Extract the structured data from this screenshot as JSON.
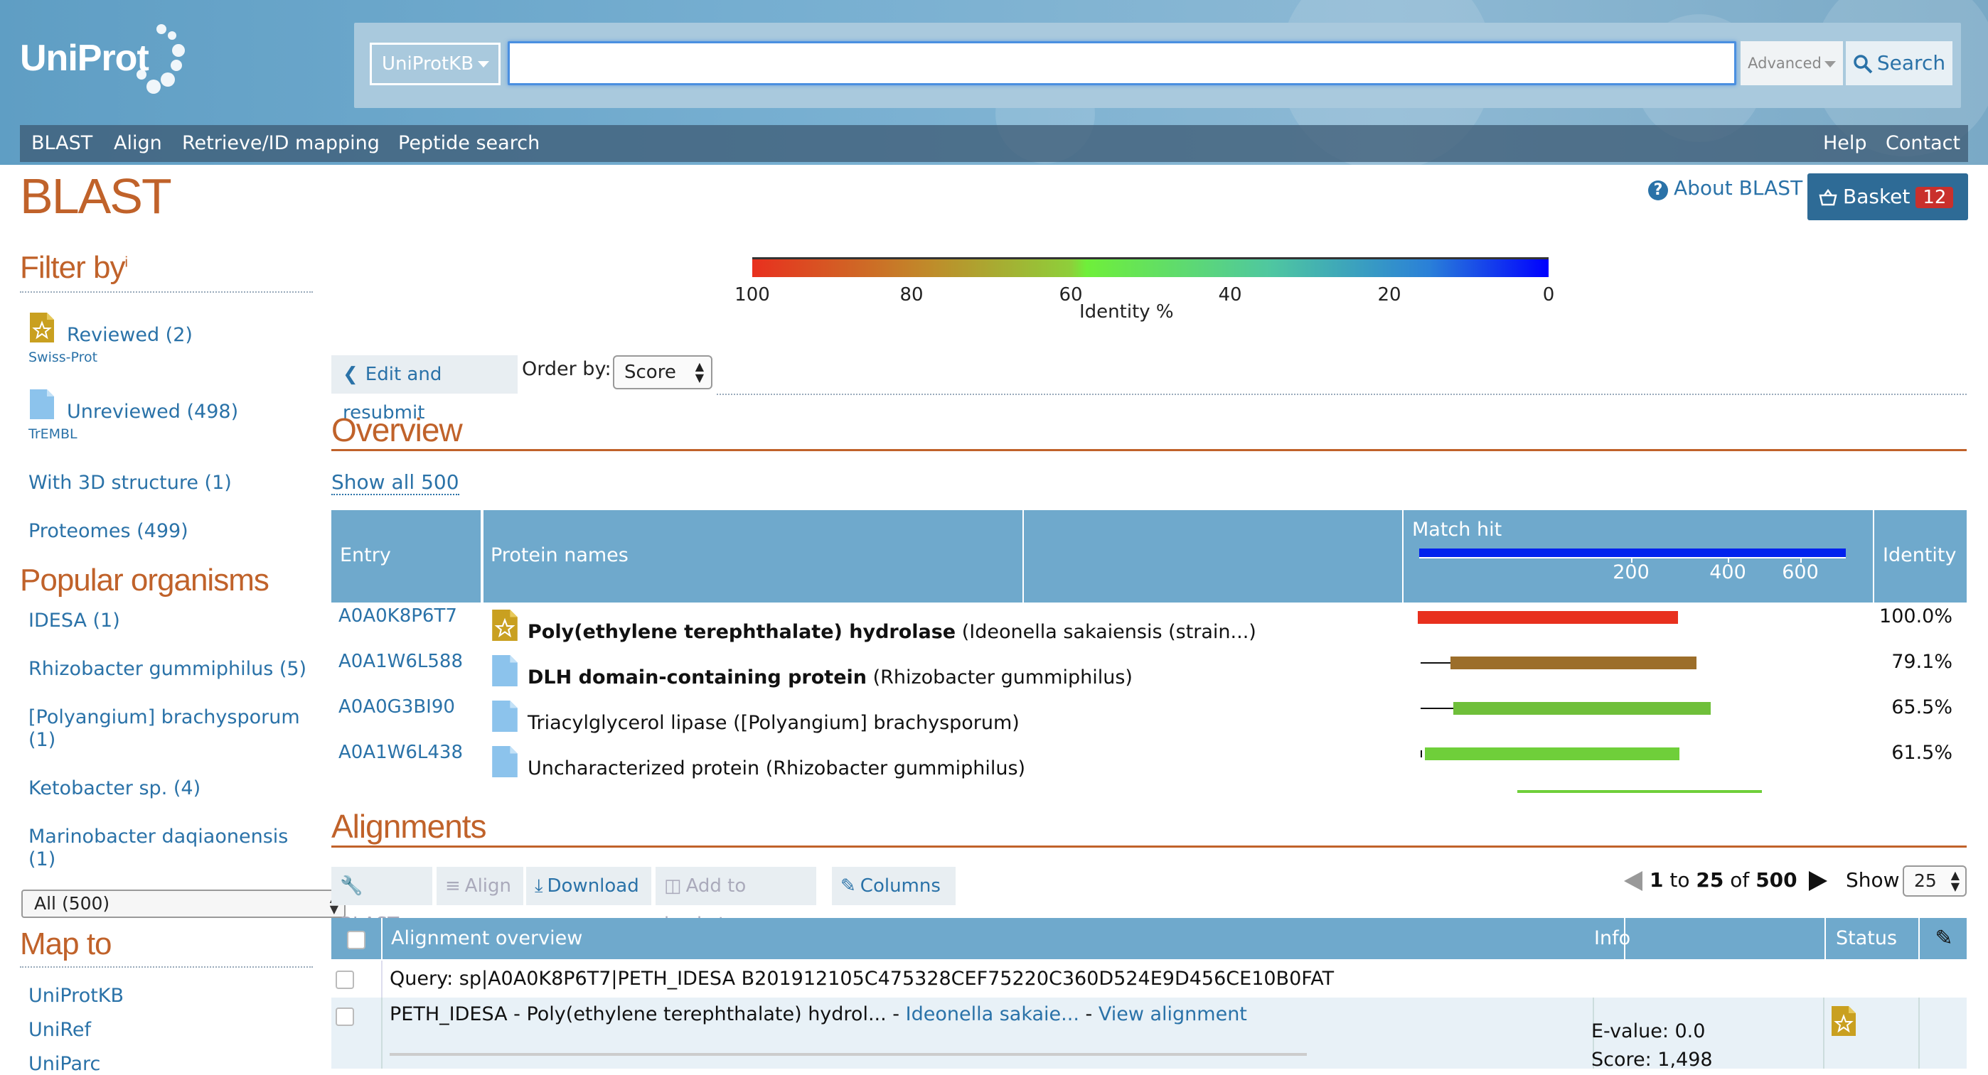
{
  "header": {
    "logo": "UniProt",
    "db_select": "UniProtKB",
    "search_value": "",
    "advanced": "Advanced",
    "search": "Search",
    "nav_left": [
      "BLAST",
      "Align",
      "Retrieve/ID mapping",
      "Peptide search"
    ],
    "nav_right": [
      "Help",
      "Contact"
    ]
  },
  "page": {
    "title": "BLAST",
    "about": "About BLAST",
    "basket_label": "Basket",
    "basket_count": "12"
  },
  "sidebar": {
    "filter_heading": "Filter by",
    "filter_sup": "i",
    "reviewed": "Reviewed (2)",
    "reviewed_sub": "Swiss-Prot",
    "unreviewed": "Unreviewed (498)",
    "unreviewed_sub": "TrEMBL",
    "with3d": "With 3D structure (1)",
    "proteomes": "Proteomes (499)",
    "popular_heading": "Popular organisms",
    "organisms": [
      "IDESA (1)",
      "Rhizobacter gummiphilus (5)",
      "[Polyangium] brachysporum",
      "(1)",
      "Ketobacter sp. (4)",
      "Marinobacter daqiaonensis",
      "(1)"
    ],
    "select_value": "All (500)",
    "map_heading": "Map to",
    "map_links": [
      "UniProtKB",
      "UniRef",
      "UniParc"
    ]
  },
  "identity_scale": {
    "ticks": [
      "100",
      "80",
      "60",
      "40",
      "20",
      "0"
    ],
    "label": "Identity %",
    "colors": [
      "#e8301e",
      "#c08a2a",
      "#6fef3a",
      "#4fc7a0",
      "#2a80d8",
      "#0000ff"
    ]
  },
  "controls": {
    "edit": "Edit and resubmit",
    "order_label": "Order by:",
    "order_value": "Score"
  },
  "overview": {
    "title": "Overview",
    "show_all": "Show all 500",
    "columns": [
      "Entry",
      "Protein names",
      "Match hit",
      "Identity"
    ],
    "match_ticks": [
      "200",
      "400",
      "600"
    ],
    "rows": [
      {
        "entry": "A0A0K8P6T7",
        "name_bold": "Poly(ethylene terephthalate) hydrolase",
        "name_rest": " (Ideonella sakaiensis (strain...)",
        "identity": "100.0%",
        "reviewed": true,
        "color": "#e8301e"
      },
      {
        "entry": "A0A1W6L588",
        "name_bold": "DLH domain-containing protein",
        "name_rest": " (Rhizobacter gummiphilus)",
        "identity": "79.1%",
        "reviewed": false,
        "color": "#9c6e2a"
      },
      {
        "entry": "A0A0G3BI90",
        "name_bold": "",
        "name_rest": "Triacylglycerol lipase ([Polyangium] brachysporum)",
        "identity": "65.5%",
        "reviewed": false,
        "color": "#6fbf3a"
      },
      {
        "entry": "A0A1W6L438",
        "name_bold": "",
        "name_rest": "Uncharacterized protein (Rhizobacter gummiphilus)",
        "identity": "61.5%",
        "reviewed": false,
        "color": "#6fcf3a"
      }
    ]
  },
  "alignments": {
    "title": "Alignments",
    "toolbar": [
      "BLAST",
      "Align",
      "Download",
      "Add to basket",
      "Columns"
    ],
    "pager_from": "1",
    "pager_to_label": "to",
    "pager_to": "25",
    "pager_of_label": "of",
    "pager_total": "500",
    "show_label": "Show",
    "show_value": "25",
    "columns": [
      "Alignment overview",
      "Info",
      "Status"
    ],
    "query": "Query: sp|A0A0K8P6T7|PETH_IDESA B201912105C475328CEF75220C360D524E9D456CE10B0FAT",
    "hit_name": "PETH_IDESA - Poly(ethylene terephthalate) hydrol...",
    "hit_sep1": " - ",
    "hit_org": "Ideonella sakaie...",
    "hit_sep2": " - ",
    "hit_view": "View alignment",
    "evalue": "E-value: 0.0",
    "score": "Score: 1,498"
  }
}
